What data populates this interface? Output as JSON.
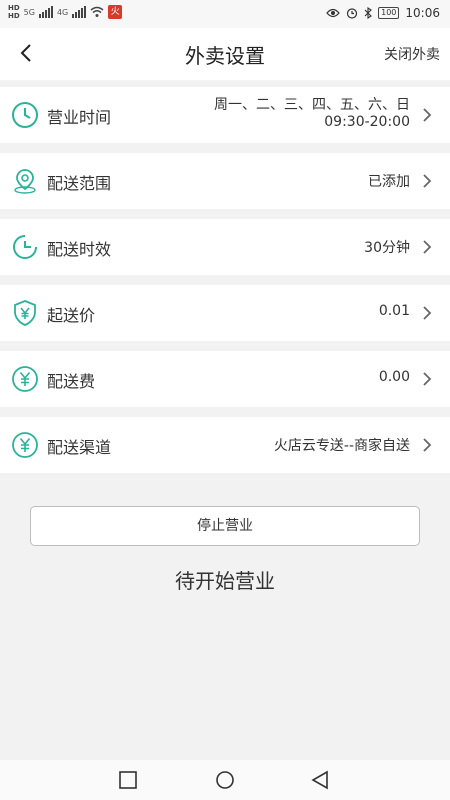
{
  "status_bar": {
    "left_labels": [
      "HD",
      "HD",
      "5G",
      "4G"
    ],
    "battery": "100",
    "time": "10:06",
    "app_badge": "火"
  },
  "header": {
    "title": "外卖设置",
    "action": "关闭外卖"
  },
  "settings": [
    {
      "label": "营业时间",
      "value_line1": "周一、二、三、四、五、六、日",
      "value_line2": "09:30-20:00",
      "icon": "clock-icon"
    },
    {
      "label": "配送范围",
      "value": "已添加",
      "icon": "location-pin-icon"
    },
    {
      "label": "配送时效",
      "value": "30分钟",
      "icon": "timer-icon"
    },
    {
      "label": "起送价",
      "value": "0.01",
      "icon": "yuan-shield-icon"
    },
    {
      "label": "配送费",
      "value": "0.00",
      "icon": "yuan-circle-icon"
    },
    {
      "label": "配送渠道",
      "value": "火店云专送--商家自送",
      "icon": "yuan-circle-icon"
    }
  ],
  "actions": {
    "stop_button": "停止营业",
    "status_text": "待开始营业"
  },
  "colors": {
    "accent": "#2bb39a"
  }
}
